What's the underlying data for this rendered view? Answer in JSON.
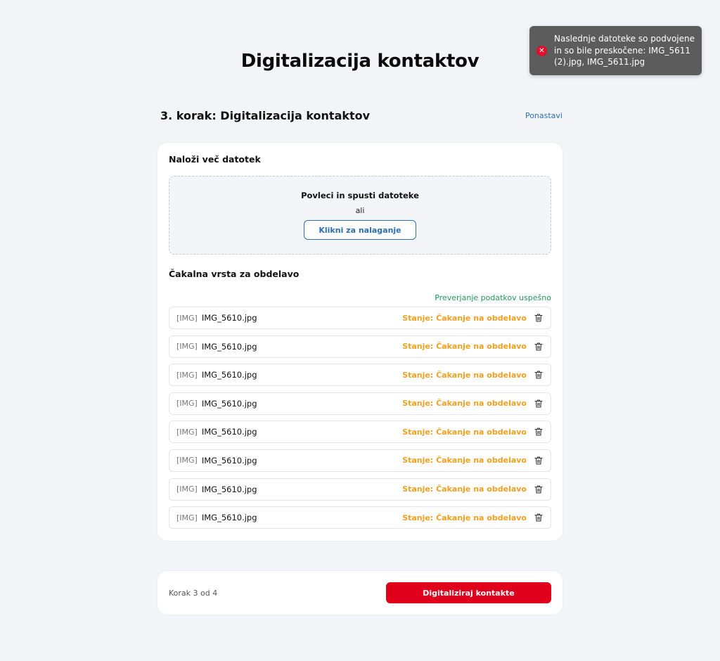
{
  "page": {
    "title": "Digitalizacija kontaktov"
  },
  "step": {
    "title": "3. korak: Digitalizacija kontaktov",
    "reset_label": "Ponastavi"
  },
  "upload": {
    "title": "Naloži več datotek",
    "drop_text": "Povleci in spusti datoteke",
    "or_text": "ali",
    "click_label": "Klikni za nalaganje"
  },
  "queue": {
    "title": "Čakalna vrsta za obdelavo",
    "validation": "Preverjanje podatkov uspešno",
    "files": [
      {
        "type": "[IMG]",
        "name": "IMG_5610.jpg",
        "status": "Stanje: Čakanje na obdelavo"
      },
      {
        "type": "[IMG]",
        "name": "IMG_5610.jpg",
        "status": "Stanje: Čakanje na obdelavo"
      },
      {
        "type": "[IMG]",
        "name": "IMG_5610.jpg",
        "status": "Stanje: Čakanje na obdelavo"
      },
      {
        "type": "[IMG]",
        "name": "IMG_5610.jpg",
        "status": "Stanje: Čakanje na obdelavo"
      },
      {
        "type": "[IMG]",
        "name": "IMG_5610.jpg",
        "status": "Stanje: Čakanje na obdelavo"
      },
      {
        "type": "[IMG]",
        "name": "IMG_5610.jpg",
        "status": "Stanje: Čakanje na obdelavo"
      },
      {
        "type": "[IMG]",
        "name": "IMG_5610.jpg",
        "status": "Stanje: Čakanje na obdelavo"
      },
      {
        "type": "[IMG]",
        "name": "IMG_5610.jpg",
        "status": "Stanje: Čakanje na obdelavo"
      }
    ],
    "delete_icon": "trash-icon"
  },
  "footer": {
    "step_counter": "Korak 3 od 4",
    "submit_label": "Digitaliziraj kontakte"
  },
  "toast": {
    "icon": "error-icon",
    "message": "Naslednje datoteke so podvojene in so bile preskočene: IMG_5611 (2).jpg, IMG_5611.jpg"
  },
  "colors": {
    "background": "#f3f4f8",
    "primary_red": "#e0001b",
    "link_blue": "#2d6fae",
    "success_green": "#1e9b5a",
    "status_orange": "#f0a020",
    "toast_bg": "#5c5c5c"
  }
}
